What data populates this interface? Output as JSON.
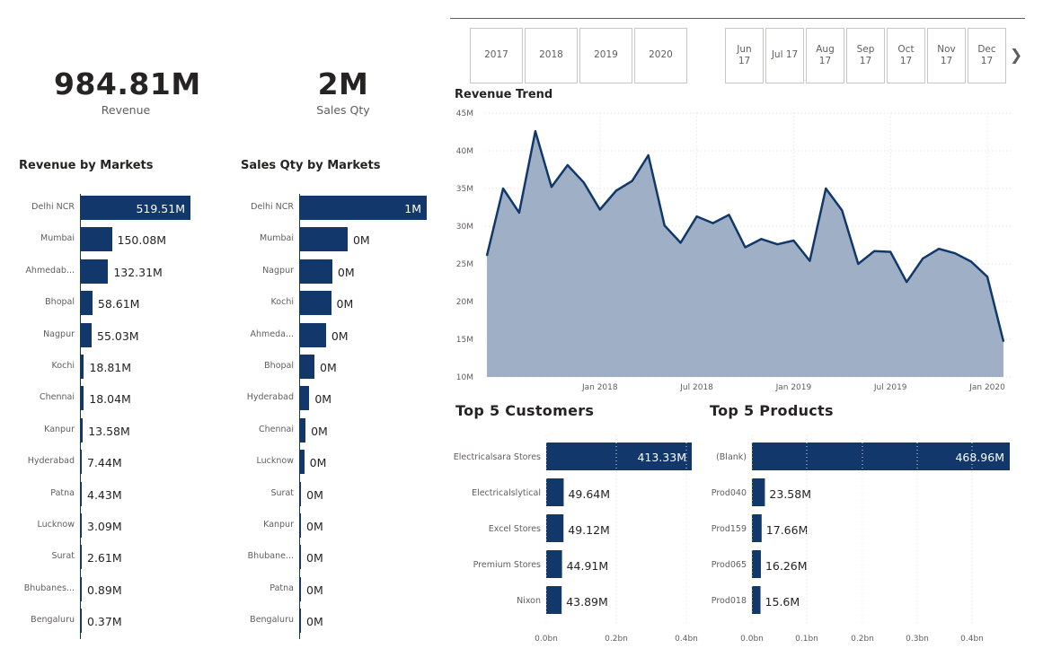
{
  "kpis": {
    "revenue": {
      "value": "984.81M",
      "label": "Revenue"
    },
    "sales_qty": {
      "value": "2M",
      "label": "Sales Qty"
    }
  },
  "revenue_by_markets": {
    "title": "Revenue by Markets",
    "rows": [
      {
        "label": "Delhi NCR",
        "value": 519.51,
        "text": "519.51M"
      },
      {
        "label": "Mumbai",
        "value": 150.08,
        "text": "150.08M"
      },
      {
        "label": "Ahmedab...",
        "value": 132.31,
        "text": "132.31M"
      },
      {
        "label": "Bhopal",
        "value": 58.61,
        "text": "58.61M"
      },
      {
        "label": "Nagpur",
        "value": 55.03,
        "text": "55.03M"
      },
      {
        "label": "Kochi",
        "value": 18.81,
        "text": "18.81M"
      },
      {
        "label": "Chennai",
        "value": 18.04,
        "text": "18.04M"
      },
      {
        "label": "Kanpur",
        "value": 13.58,
        "text": "13.58M"
      },
      {
        "label": "Hyderabad",
        "value": 7.44,
        "text": "7.44M"
      },
      {
        "label": "Patna",
        "value": 4.43,
        "text": "4.43M"
      },
      {
        "label": "Lucknow",
        "value": 3.09,
        "text": "3.09M"
      },
      {
        "label": "Surat",
        "value": 2.61,
        "text": "2.61M"
      },
      {
        "label": "Bhubanes...",
        "value": 0.89,
        "text": "0.89M"
      },
      {
        "label": "Bengaluru",
        "value": 0.37,
        "text": "0.37M"
      }
    ]
  },
  "sales_qty_by_markets": {
    "title": "Sales Qty by Markets",
    "rows": [
      {
        "label": "Delhi NCR",
        "value": 1.0,
        "text": "1M"
      },
      {
        "label": "Mumbai",
        "value": 0.38,
        "text": "0M"
      },
      {
        "label": "Nagpur",
        "value": 0.26,
        "text": "0M"
      },
      {
        "label": "Kochi",
        "value": 0.25,
        "text": "0M"
      },
      {
        "label": "Ahmeda...",
        "value": 0.21,
        "text": "0M"
      },
      {
        "label": "Bhopal",
        "value": 0.12,
        "text": "0M"
      },
      {
        "label": "Hyderabad",
        "value": 0.08,
        "text": "0M"
      },
      {
        "label": "Chennai",
        "value": 0.05,
        "text": "0M"
      },
      {
        "label": "Lucknow",
        "value": 0.04,
        "text": "0M"
      },
      {
        "label": "Surat",
        "value": 0.015,
        "text": "0M"
      },
      {
        "label": "Kanpur",
        "value": 0.012,
        "text": "0M"
      },
      {
        "label": "Bhubane...",
        "value": 0.01,
        "text": "0M"
      },
      {
        "label": "Patna",
        "value": 0.008,
        "text": "0M"
      },
      {
        "label": "Bengaluru",
        "value": 0.006,
        "text": "0M"
      }
    ]
  },
  "year_slicer": [
    "2017",
    "2018",
    "2019",
    "2020"
  ],
  "month_slicer": [
    "Jun\n17",
    "Jul 17",
    "Aug\n17",
    "Sep\n17",
    "Oct\n17",
    "Nov\n17",
    "Dec\n17"
  ],
  "slicer_next_icon": "chevron-right-icon",
  "chart_data": [
    {
      "type": "area",
      "title": "Revenue Trend",
      "ylim": [
        10,
        45
      ],
      "y_ticks": [
        "10M",
        "15M",
        "20M",
        "25M",
        "30M",
        "35M",
        "40M",
        "45M"
      ],
      "x_ticks": [
        {
          "label": "Jan 2018",
          "index": 7
        },
        {
          "label": "Jul 2018",
          "index": 13
        },
        {
          "label": "Jan 2019",
          "index": 19
        },
        {
          "label": "Jul 2019",
          "index": 25
        },
        {
          "label": "Jan 2020",
          "index": 31
        }
      ],
      "x_start": "Jun 2017",
      "values": [
        26.1,
        35.0,
        31.8,
        42.6,
        35.2,
        38.1,
        35.8,
        32.2,
        34.7,
        36.0,
        39.4,
        30.1,
        27.8,
        31.3,
        30.4,
        31.5,
        27.2,
        28.3,
        27.6,
        28.1,
        25.4,
        35.0,
        32.1,
        25.0,
        26.7,
        26.6,
        22.6,
        25.7,
        27.0,
        26.4,
        25.3,
        23.3,
        14.7
      ],
      "color": "#12386b",
      "fill": "#9fb0c6",
      "grid": true
    },
    {
      "type": "bar",
      "title": "Top 5 Customers",
      "categories": [
        "Electricalsara Stores",
        "Electricalslytical",
        "Excel Stores",
        "Premium Stores",
        "Nixon"
      ],
      "values": [
        413.33,
        49.64,
        49.12,
        44.91,
        43.89
      ],
      "labels": [
        "413.33M",
        "49.64M",
        "49.12M",
        "44.91M",
        "43.89M"
      ],
      "x_ticks": [
        "0.0bn",
        "0.2bn",
        "0.4bn"
      ],
      "xlim": [
        0,
        400
      ]
    },
    {
      "type": "bar",
      "title": "Top 5 Products",
      "categories": [
        "(Blank)",
        "Prod040",
        "Prod159",
        "Prod065",
        "Prod018"
      ],
      "values": [
        468.96,
        23.58,
        17.66,
        16.26,
        15.6
      ],
      "labels": [
        "468.96M",
        "23.58M",
        "17.66M",
        "16.26M",
        "15.6M"
      ],
      "x_ticks": [
        "0.0bn",
        "0.1bn",
        "0.2bn",
        "0.3bn",
        "0.4bn"
      ],
      "xlim": [
        0,
        400
      ]
    }
  ]
}
